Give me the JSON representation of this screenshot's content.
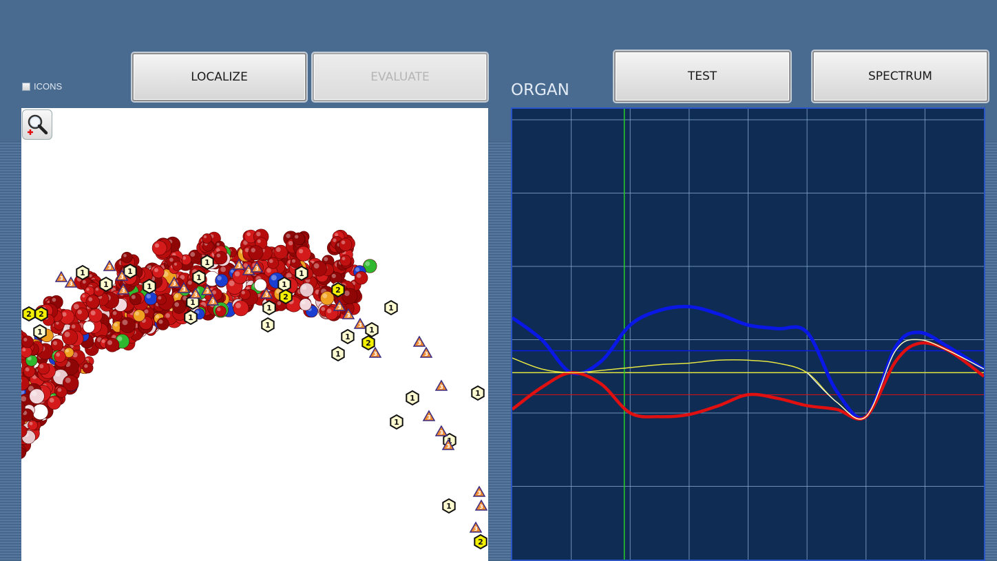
{
  "toolbar": {
    "icons_label": "ICONS",
    "localize_label": "LOCALIZE",
    "evaluate_label": "EVALUATE",
    "test_label": "TEST",
    "spectrum_label": "SPECTRUM"
  },
  "organ_label": "ORGAN",
  "viewer": {
    "zoom_icon": "zoom-in-icon",
    "model": "molecular-ring-model",
    "marker_labels": [
      "1",
      "2",
      "3"
    ]
  },
  "colors": {
    "background": "#4a6b90",
    "chart_bg": "#0f2c55",
    "grid": "#8fb0d6",
    "blue_series": "#0a18e6",
    "red_series": "#e01010",
    "yellow_series": "#e6e640",
    "white_series": "#ffffff",
    "cursor": "#26d026"
  },
  "chart_data": {
    "type": "line",
    "title": "",
    "xlabel": "",
    "ylabel": "",
    "xlim": [
      0,
      8
    ],
    "ylim": [
      0,
      6.15
    ],
    "grid": true,
    "cursor_x": 1.9,
    "reference_lines": [
      {
        "color": "blue",
        "y": 2.85
      },
      {
        "color": "yellow",
        "y": 2.55
      },
      {
        "color": "red",
        "y": 2.25
      }
    ],
    "series": [
      {
        "color": "blue",
        "x": [
          0,
          0.5,
          1,
          1.5,
          2,
          2.5,
          3,
          3.5,
          4,
          4.5,
          5,
          5.5,
          6,
          6.5,
          6.9,
          7.4,
          8
        ],
        "y": [
          3.3,
          3.0,
          2.55,
          2.7,
          3.2,
          3.4,
          3.45,
          3.35,
          3.2,
          3.15,
          3.1,
          2.3,
          1.95,
          2.9,
          3.1,
          2.9,
          2.6
        ]
      },
      {
        "color": "red",
        "x": [
          0,
          0.5,
          1,
          1.5,
          2,
          2.5,
          3,
          3.5,
          4,
          4.5,
          5,
          5.5,
          6,
          6.5,
          6.9,
          7.4,
          8
        ],
        "y": [
          2.05,
          2.35,
          2.55,
          2.4,
          2.0,
          1.95,
          1.98,
          2.1,
          2.25,
          2.2,
          2.1,
          2.05,
          1.95,
          2.7,
          2.95,
          2.85,
          2.5
        ]
      },
      {
        "color": "yellow",
        "x": [
          0,
          0.5,
          1,
          1.5,
          2,
          2.5,
          3,
          3.5,
          4,
          4.5,
          5,
          5.5,
          6,
          6.5,
          6.9,
          7.4,
          8
        ],
        "y": [
          2.75,
          2.6,
          2.55,
          2.58,
          2.62,
          2.66,
          2.68,
          2.72,
          2.72,
          2.68,
          2.55,
          2.15,
          1.95,
          2.85,
          3.0,
          2.85,
          2.6
        ]
      }
    ]
  }
}
